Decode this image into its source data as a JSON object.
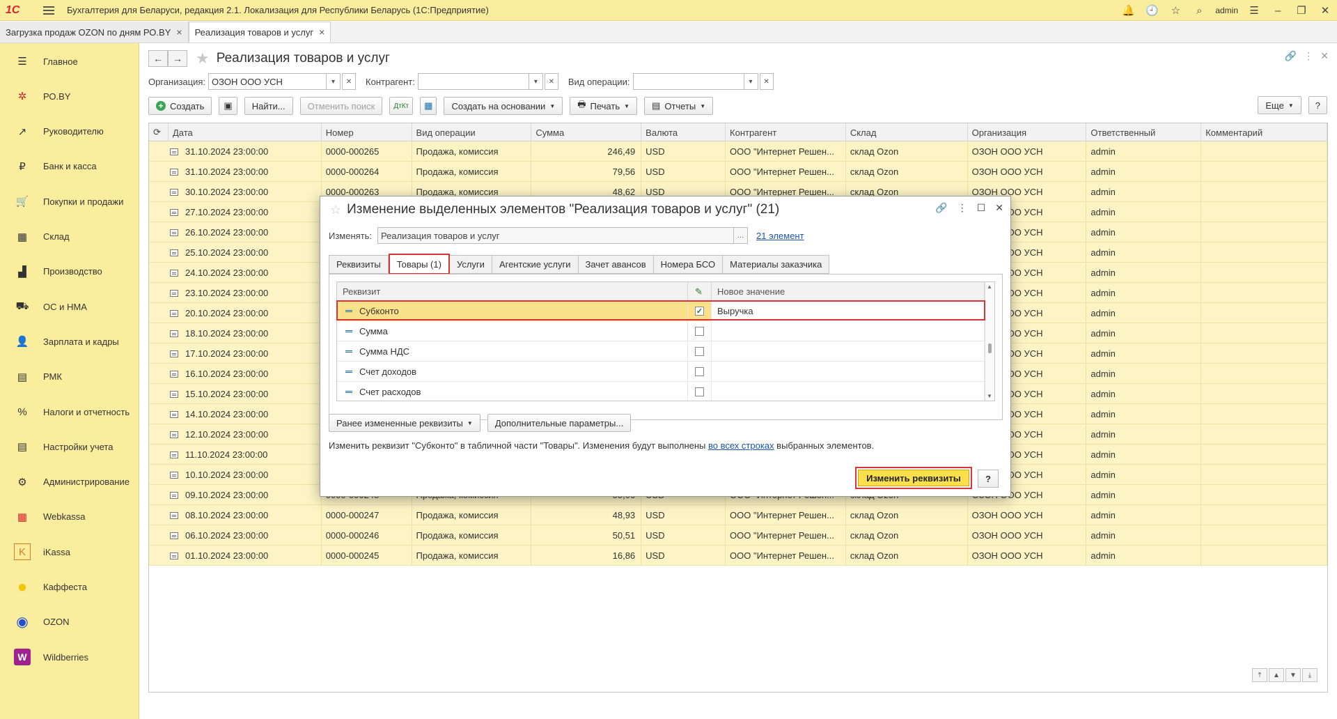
{
  "app": {
    "title": "Бухгалтерия для Беларуси, редакция 2.1. Локализация для Республики Беларусь    (1С:Предприятие)",
    "logo": "1С",
    "user": "admin"
  },
  "window_tabs": [
    {
      "label": "Загрузка продаж OZON по дням РО.BY",
      "close": "×"
    },
    {
      "label": "Реализация товаров и услуг",
      "close": "×"
    }
  ],
  "sidebar": {
    "items": [
      {
        "label": "Главное",
        "icon": "menu-icon",
        "glyph": "☰"
      },
      {
        "label": "РО.BY",
        "icon": "ro-icon",
        "glyph": "✲"
      },
      {
        "label": "Руководителю",
        "icon": "chart-icon",
        "glyph": "↗"
      },
      {
        "label": "Банк и касса",
        "icon": "bank-icon",
        "glyph": "₽"
      },
      {
        "label": "Покупки и продажи",
        "icon": "cart-icon",
        "glyph": "🛒"
      },
      {
        "label": "Склад",
        "icon": "warehouse-icon",
        "glyph": "▦"
      },
      {
        "label": "Производство",
        "icon": "factory-icon",
        "glyph": "▟"
      },
      {
        "label": "ОС и НМА",
        "icon": "truck-icon",
        "glyph": "⛟"
      },
      {
        "label": "Зарплата и кадры",
        "icon": "person-icon",
        "glyph": "👤"
      },
      {
        "label": "РМК",
        "icon": "register-icon",
        "glyph": "▤"
      },
      {
        "label": "Налоги и отчетность",
        "icon": "tax-icon",
        "glyph": "%"
      },
      {
        "label": "Настройки учета",
        "icon": "settings-doc-icon",
        "glyph": "▤"
      },
      {
        "label": "Администрирование",
        "icon": "gear-icon",
        "glyph": "⚙"
      },
      {
        "label": "Webkassa",
        "icon": "webkassa-icon",
        "glyph": "▦"
      },
      {
        "label": "iKassa",
        "icon": "ikassa-icon",
        "glyph": "K"
      },
      {
        "label": "Каффеста",
        "icon": "kaffesta-icon",
        "glyph": "●"
      },
      {
        "label": "OZON",
        "icon": "ozon-icon",
        "glyph": "◉"
      },
      {
        "label": "Wildberries",
        "icon": "wildberries-icon",
        "glyph": "W"
      }
    ]
  },
  "form": {
    "title": "Реализация товаров и услуг",
    "filters": {
      "org_label": "Организация:",
      "org_value": "ОЗОН ООО УСН",
      "contr_label": "Контрагент:",
      "contr_value": "",
      "op_label": "Вид операции:",
      "op_value": ""
    },
    "toolbar": {
      "create": "Создать",
      "find": "Найти...",
      "cancel_search": "Отменить поиск",
      "create_based": "Создать на основании",
      "print": "Печать",
      "reports": "Отчеты",
      "more": "Еще",
      "help": "?"
    }
  },
  "table": {
    "columns": [
      "Дата",
      "Номер",
      "Вид операции",
      "Сумма",
      "Валюта",
      "Контрагент",
      "Склад",
      "Организация",
      "Ответственный",
      "Комментарий"
    ],
    "rows": [
      [
        "31.10.2024 23:00:00",
        "0000-000265",
        "Продажа, комиссия",
        "246,49",
        "USD",
        "ООО \"Интернет Решен...",
        "склад Ozon",
        "ОЗОН ООО УСН",
        "admin",
        ""
      ],
      [
        "31.10.2024 23:00:00",
        "0000-000264",
        "Продажа, комиссия",
        "79,56",
        "USD",
        "ООО \"Интернет Решен...",
        "склад Ozon",
        "ОЗОН ООО УСН",
        "admin",
        ""
      ],
      [
        "30.10.2024 23:00:00",
        "0000-000263",
        "Продажа, комиссия",
        "48,62",
        "USD",
        "ООО \"Интернет Решен...",
        "склад Ozon",
        "ОЗОН ООО УСН",
        "admin",
        ""
      ],
      [
        "27.10.2024 23:00:00",
        "",
        "",
        "",
        "",
        "",
        "",
        "ОЗОН ООО УСН",
        "admin",
        ""
      ],
      [
        "26.10.2024 23:00:00",
        "",
        "",
        "",
        "",
        "",
        "",
        "ОЗОН ООО УСН",
        "admin",
        ""
      ],
      [
        "25.10.2024 23:00:00",
        "",
        "",
        "",
        "",
        "",
        "",
        "ОЗОН ООО УСН",
        "admin",
        ""
      ],
      [
        "24.10.2024 23:00:00",
        "",
        "",
        "",
        "",
        "",
        "",
        "ОЗОН ООО УСН",
        "admin",
        ""
      ],
      [
        "23.10.2024 23:00:00",
        "",
        "",
        "",
        "",
        "",
        "",
        "ОЗОН ООО УСН",
        "admin",
        ""
      ],
      [
        "20.10.2024 23:00:00",
        "",
        "",
        "",
        "",
        "",
        "",
        "ОЗОН ООО УСН",
        "admin",
        ""
      ],
      [
        "18.10.2024 23:00:00",
        "",
        "",
        "",
        "",
        "",
        "",
        "ОЗОН ООО УСН",
        "admin",
        ""
      ],
      [
        "17.10.2024 23:00:00",
        "",
        "",
        "",
        "",
        "",
        "",
        "ОЗОН ООО УСН",
        "admin",
        ""
      ],
      [
        "16.10.2024 23:00:00",
        "",
        "",
        "",
        "",
        "",
        "",
        "ОЗОН ООО УСН",
        "admin",
        ""
      ],
      [
        "15.10.2024 23:00:00",
        "",
        "",
        "",
        "",
        "",
        "",
        "ОЗОН ООО УСН",
        "admin",
        ""
      ],
      [
        "14.10.2024 23:00:00",
        "",
        "",
        "",
        "",
        "",
        "",
        "ОЗОН ООО УСН",
        "admin",
        ""
      ],
      [
        "12.10.2024 23:00:00",
        "",
        "",
        "",
        "",
        "",
        "",
        "ОЗОН ООО УСН",
        "admin",
        ""
      ],
      [
        "11.10.2024 23:00:00",
        "",
        "",
        "",
        "",
        "",
        "",
        "ОЗОН ООО УСН",
        "admin",
        ""
      ],
      [
        "10.10.2024 23:00:00",
        "",
        "",
        "",
        "",
        "",
        "",
        "ОЗОН ООО УСН",
        "admin",
        ""
      ],
      [
        "09.10.2024 23:00:00",
        "0000-000248",
        "Продажа, комиссия",
        "55,06",
        "USD",
        "ООО \"Интернет Решен...",
        "склад Ozon",
        "ОЗОН ООО УСН",
        "admin",
        ""
      ],
      [
        "08.10.2024 23:00:00",
        "0000-000247",
        "Продажа, комиссия",
        "48,93",
        "USD",
        "ООО \"Интернет Решен...",
        "склад Ozon",
        "ОЗОН ООО УСН",
        "admin",
        ""
      ],
      [
        "06.10.2024 23:00:00",
        "0000-000246",
        "Продажа, комиссия",
        "50,51",
        "USD",
        "ООО \"Интернет Решен...",
        "склад Ozon",
        "ОЗОН ООО УСН",
        "admin",
        ""
      ],
      [
        "01.10.2024 23:00:00",
        "0000-000245",
        "Продажа, комиссия",
        "16,86",
        "USD",
        "ООО \"Интернет Решен...",
        "склад Ozon",
        "ОЗОН ООО УСН",
        "admin",
        ""
      ]
    ]
  },
  "dialog": {
    "title": "Изменение выделенных элементов \"Реализация товаров и услуг\" (21)",
    "change_label": "Изменять:",
    "change_value": "Реализация товаров и услуг",
    "elements_link": "21 элемент",
    "tabs": [
      "Реквизиты",
      "Товары (1)",
      "Услуги",
      "Агентские услуги",
      "Зачет авансов",
      "Номера БСО",
      "Материалы заказчика"
    ],
    "active_tab": 1,
    "inner_columns": [
      "Реквизит",
      "Новое значение"
    ],
    "inner_rows": [
      {
        "name": "Субконто",
        "checked": true,
        "value": "Выручка"
      },
      {
        "name": "Сумма",
        "checked": false,
        "value": ""
      },
      {
        "name": "Сумма НДС",
        "checked": false,
        "value": ""
      },
      {
        "name": "Счет доходов",
        "checked": false,
        "value": ""
      },
      {
        "name": "Счет расходов",
        "checked": false,
        "value": ""
      }
    ],
    "btn_prev": "Ранее измененные реквизиты",
    "btn_extra": "Дополнительные параметры...",
    "info_before": "Изменить реквизит \"Субконто\" в табличной части \"Товары\". Изменения будут выполнены ",
    "info_link": "во всех строках",
    "info_after": " выбранных элементов.",
    "btn_apply": "Изменить реквизиты",
    "btn_help": "?"
  },
  "colors": {
    "accent_yellow": "#fbed9e",
    "row_yellow": "#fdf4c6",
    "primary_button": "#fbe04b",
    "highlight_red": "#d9333a",
    "link_blue": "#1a56a8"
  }
}
